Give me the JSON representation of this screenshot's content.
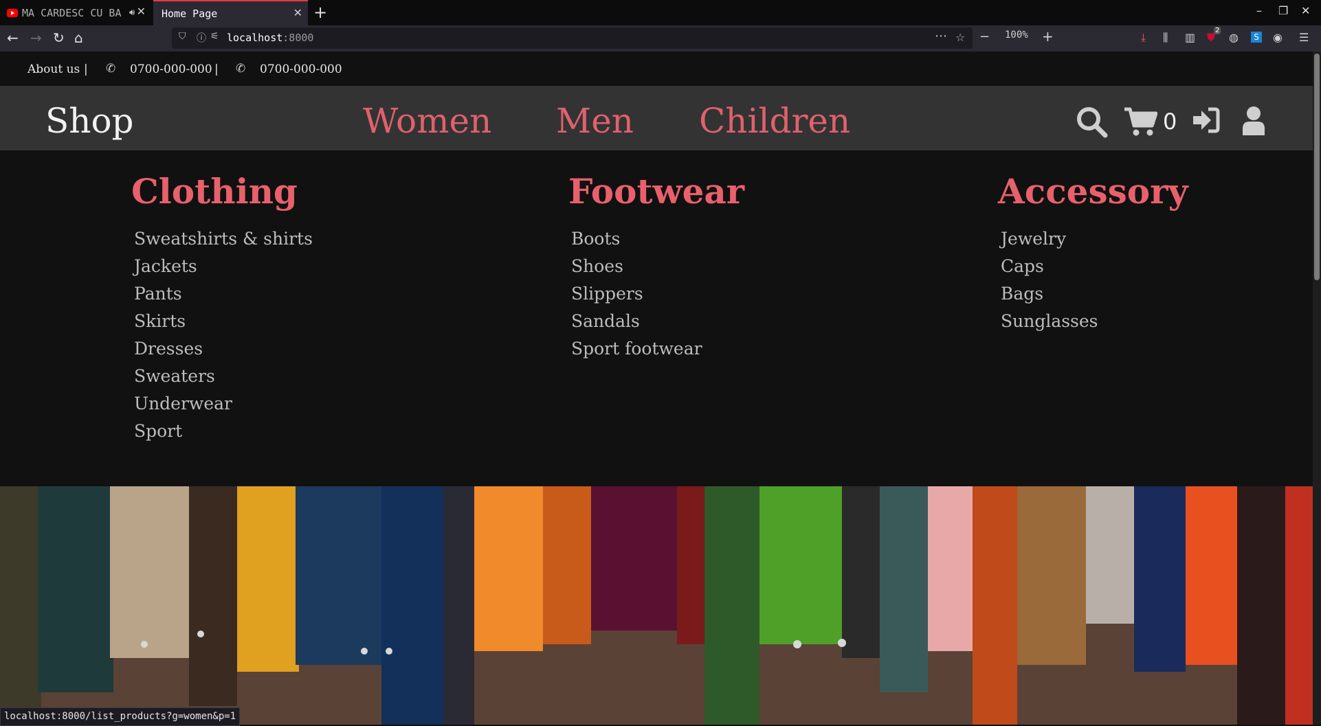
{
  "browser": {
    "tabs": [
      {
        "title": "MA CARDESC CU BA",
        "icon": "youtube-icon",
        "audio": "speaker-icon"
      },
      {
        "title": "Home Page"
      }
    ],
    "url_host": "localhost",
    "url_port": ":8000",
    "zoom": "100%",
    "extension_badge": "2",
    "status_url": "localhost:8000/list_products?g=women&p=1"
  },
  "topbar": {
    "about": "About us",
    "separator": "|",
    "phone": "0700-000-000",
    "whatsapp": "0700-000-000"
  },
  "header": {
    "brand": "Shop",
    "nav": [
      "Women",
      "Men",
      "Children"
    ],
    "cart_count": "0"
  },
  "menu": {
    "columns": [
      {
        "title": "Clothing",
        "items": [
          "Sweatshirts & shirts",
          "Jackets",
          "Pants",
          "Skirts",
          "Dresses",
          "Sweaters",
          "Underwear",
          "Sport"
        ]
      },
      {
        "title": "Footwear",
        "items": [
          "Boots",
          "Shoes",
          "Slippers",
          "Sandals",
          "Sport footwear"
        ]
      },
      {
        "title": "Accessory",
        "items": [
          "Jewelry",
          "Caps",
          "Bags",
          "Sunglasses"
        ]
      }
    ]
  },
  "colors": {
    "accent": "#e8606c",
    "header_bg": "#333333",
    "page_bg": "#111111"
  }
}
